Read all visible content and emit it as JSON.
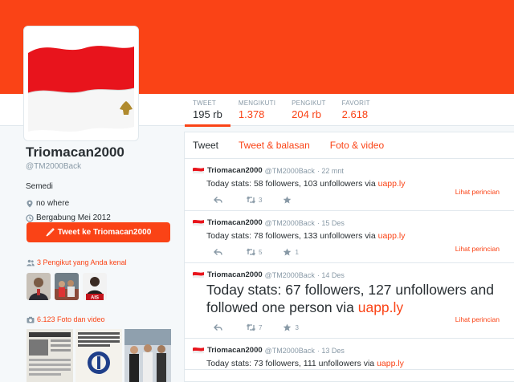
{
  "profile": {
    "name": "Triomacan2000",
    "handle": "@TM2000Back",
    "bio": "Semedi",
    "location": "no where",
    "joined": "Bergabung Mei 2012",
    "tweet_to_label": "Tweet ke Triomacan2000",
    "followers_known": "3 Pengikut yang Anda kenal",
    "photos_videos": "6.123 Foto dan video"
  },
  "stats": [
    {
      "label": "TWEET",
      "value": "195 rb"
    },
    {
      "label": "MENGIKUTI",
      "value": "1.378"
    },
    {
      "label": "PENGIKUT",
      "value": "204 rb"
    },
    {
      "label": "FAVORIT",
      "value": "2.618"
    }
  ],
  "tabs": [
    "Tweet",
    "Tweet & balasan",
    "Foto & video"
  ],
  "tweets": [
    {
      "name": "Triomacan2000",
      "handle": "@TM2000Back",
      "time": "· 22 mnt",
      "text": "Today stats: 58 followers, 103 unfollowers via ",
      "link": "uapp.ly",
      "retweets": "3",
      "favorites": "",
      "detail": "Lihat perincian"
    },
    {
      "name": "Triomacan2000",
      "handle": "@TM2000Back",
      "time": "· 15 Des",
      "text": "Today stats: 78 followers, 133 unfollowers via ",
      "link": "uapp.ly",
      "retweets": "5",
      "favorites": "1",
      "detail": "Lihat perincian"
    },
    {
      "name": "Triomacan2000",
      "handle": "@TM2000Back",
      "time": "· 14 Des",
      "text": "Today stats: 67 followers, 127 unfollowers and followed one person via ",
      "link": "uapp.ly",
      "retweets": "7",
      "favorites": "3",
      "detail": "Lihat perincian"
    },
    {
      "name": "Triomacan2000",
      "handle": "@TM2000Back",
      "time": "· 13 Des",
      "text": "Today stats: 73 followers, 111 unfollowers via ",
      "link": "uapp.ly",
      "retweets": "",
      "favorites": "",
      "detail": ""
    }
  ],
  "colors": {
    "accent": "#fa4316",
    "flag_red": "#e8141c",
    "text": "#292f33",
    "muted": "#8899a6"
  },
  "icons": [
    "location-pin-icon",
    "calendar-icon",
    "quill-icon",
    "people-icon",
    "camera-icon",
    "reply-icon",
    "retweet-icon",
    "favorite-star-icon",
    "indonesian-flag-icon"
  ]
}
